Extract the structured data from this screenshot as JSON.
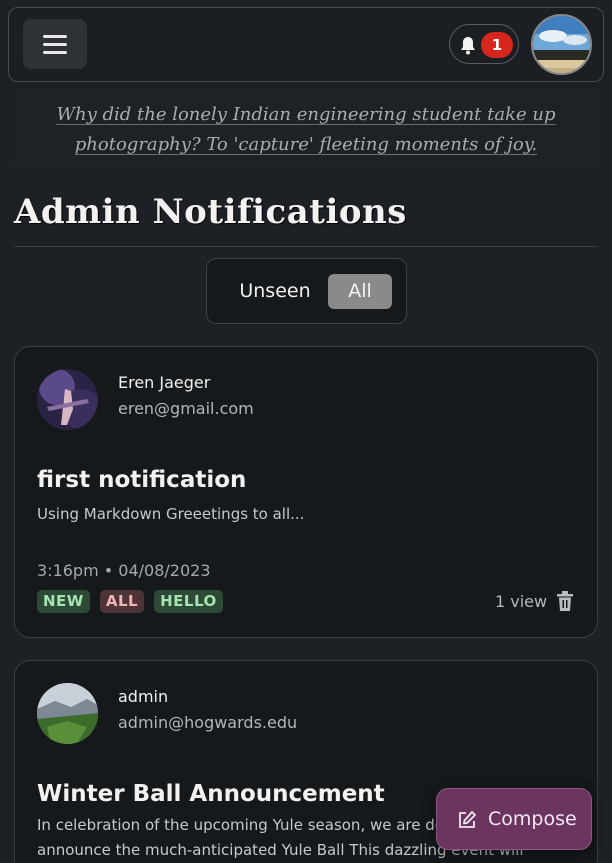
{
  "header": {
    "notification_count": "1",
    "icons": [
      "menu-icon",
      "bell-icon"
    ]
  },
  "joke": {
    "line1": "Why did the lonely Indian engineering student take up",
    "line2": "photography? To 'capture' fleeting moments of joy."
  },
  "page_title": "Admin Notifications",
  "filter": {
    "unseen_label": "Unseen",
    "all_label": "All",
    "selected": "All"
  },
  "notifications": [
    {
      "name": "Eren Jaeger",
      "email": "eren@gmail.com",
      "title": "first notification",
      "body": "Using Markdown Greeetings to all...",
      "time": "3:16pm • 04/08/2023",
      "tags": [
        "NEW",
        "ALL",
        "HELLO"
      ],
      "views": "1 view"
    },
    {
      "name": "admin",
      "email": "admin@hogwards.edu",
      "title": "Winter Ball Announcement",
      "body": "In celebration of the upcoming Yule season, we are delighted to announce the much-anticipated Yule Ball This dazzling event will"
    }
  ],
  "compose_label": "Compose",
  "colors": {
    "background": "#1d2024",
    "badge_red": "#d7261e",
    "compose_bg": "#6b3560",
    "tag_green": "#a6e3b0",
    "tag_red": "#f0b3b8"
  }
}
